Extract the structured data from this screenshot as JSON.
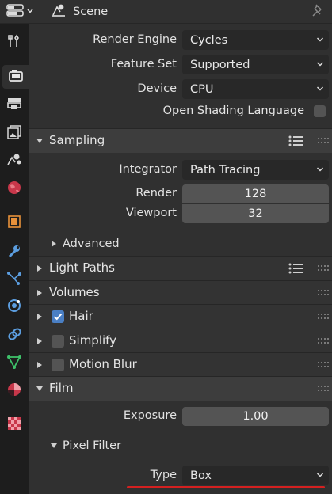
{
  "header": {
    "title": "Scene",
    "editor_icon": "properties-editor-icon",
    "pin_icon": "pin-icon"
  },
  "tabs": [
    {
      "name": "tool-tab",
      "icon": "tool-icon"
    },
    {
      "name": "render-tab",
      "icon": "camera-back-icon",
      "active": true
    },
    {
      "name": "output-tab",
      "icon": "printer-icon"
    },
    {
      "name": "view-layer-tab",
      "icon": "images-icon"
    },
    {
      "name": "scene-tab",
      "icon": "scene-icon"
    },
    {
      "name": "world-tab",
      "icon": "world-icon"
    },
    {
      "name": "object-tab",
      "icon": "object-icon"
    },
    {
      "name": "modifier-tab",
      "icon": "wrench-icon"
    },
    {
      "name": "particles-tab",
      "icon": "particles-icon"
    },
    {
      "name": "physics-tab",
      "icon": "physics-icon"
    },
    {
      "name": "constraints-tab",
      "icon": "constraint-icon"
    },
    {
      "name": "data-tab",
      "icon": "mesh-data-icon"
    },
    {
      "name": "material-tab",
      "icon": "material-icon"
    },
    {
      "name": "texture-tab",
      "icon": "texture-checker-icon"
    }
  ],
  "render": {
    "render_engine_label": "Render Engine",
    "render_engine_value": "Cycles",
    "feature_set_label": "Feature Set",
    "feature_set_value": "Supported",
    "device_label": "Device",
    "device_value": "CPU",
    "osl_label": "Open Shading Language"
  },
  "sampling": {
    "title": "Sampling",
    "integrator_label": "Integrator",
    "integrator_value": "Path Tracing",
    "render_label": "Render",
    "render_value": "128",
    "viewport_label": "Viewport",
    "viewport_value": "32",
    "advanced_label": "Advanced"
  },
  "panels": {
    "light_paths": "Light Paths",
    "volumes": "Volumes",
    "hair": "Hair",
    "simplify": "Simplify",
    "motion_blur": "Motion Blur",
    "film": "Film"
  },
  "film": {
    "exposure_label": "Exposure",
    "exposure_value": "1.00",
    "pixel_filter_label": "Pixel Filter",
    "type_label": "Type",
    "type_value": "Box"
  },
  "colors": {
    "checkbox_on": "#4a7fc4",
    "highlight_underline": "#d42020"
  }
}
